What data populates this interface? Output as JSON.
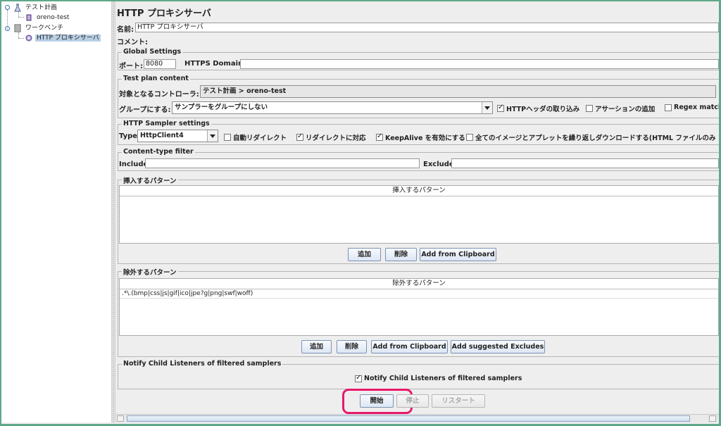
{
  "tree": {
    "items": [
      {
        "label": "テスト計画"
      },
      {
        "label": "oreno-test"
      },
      {
        "label": "ワークベンチ"
      },
      {
        "label": "HTTP プロキシサーバ"
      }
    ]
  },
  "panel": {
    "title": "HTTP プロキシサーバ",
    "name_label": "名前:",
    "name_value": "HTTP プロキシサーバ",
    "comment_label": "コメント:"
  },
  "global_settings": {
    "title": "Global Settings",
    "port_label": "ポート:",
    "port_value": "8080",
    "https_label": "HTTPS Domains :",
    "https_value": ""
  },
  "test_plan_content": {
    "title": "Test plan content",
    "controller_label": "対象となるコントローラ:",
    "controller_value": "テスト計画 > oreno-test",
    "group_label": "グループにする:",
    "group_value": "サンプラーをグループにしない",
    "cb_headers": "HTTPヘッダの取り込み",
    "cb_assert": "アサーションの追加",
    "cb_regex": "Regex matchi"
  },
  "sampler_settings": {
    "title": "HTTP Sampler settings",
    "type_label": "Type:",
    "type_value": "HttpClient4",
    "cb_auto_redirect": "自動リダイレクト",
    "cb_follow_redirect": "リダイレクトに対応",
    "cb_keepalive": "KeepAlive を有効にする",
    "cb_download": "全てのイメージとアプレットを繰り返しダウンロードする(HTML ファイルのみ"
  },
  "content_type": {
    "title": "Content-type filter",
    "include_label": "Include:",
    "include_value": "",
    "exclude_label": "Exclude:",
    "exclude_value": ""
  },
  "include_patterns": {
    "title": "挿入するパターン",
    "column": "挿入するパターン",
    "add": "追加",
    "delete": "削除",
    "clipboard": "Add from Clipboard"
  },
  "exclude_patterns": {
    "title": "除外するパターン",
    "column": "除外するパターン",
    "rows": [
      ".*\\.(bmp|css|js|gif|ico|jpe?g|png|swf|woff)"
    ],
    "add": "追加",
    "delete": "削除",
    "clipboard": "Add from Clipboard",
    "suggested": "Add suggested Excludes"
  },
  "notify": {
    "title": "Notify Child Listeners of filtered samplers",
    "checkbox": "Notify Child Listeners of filtered samplers"
  },
  "controls": {
    "start": "開始",
    "stop": "停止",
    "restart": "リスタート"
  },
  "colors": {
    "highlight": "#e8196b",
    "selection": "#b8cfe5",
    "outer_border": "#5fa98a"
  }
}
